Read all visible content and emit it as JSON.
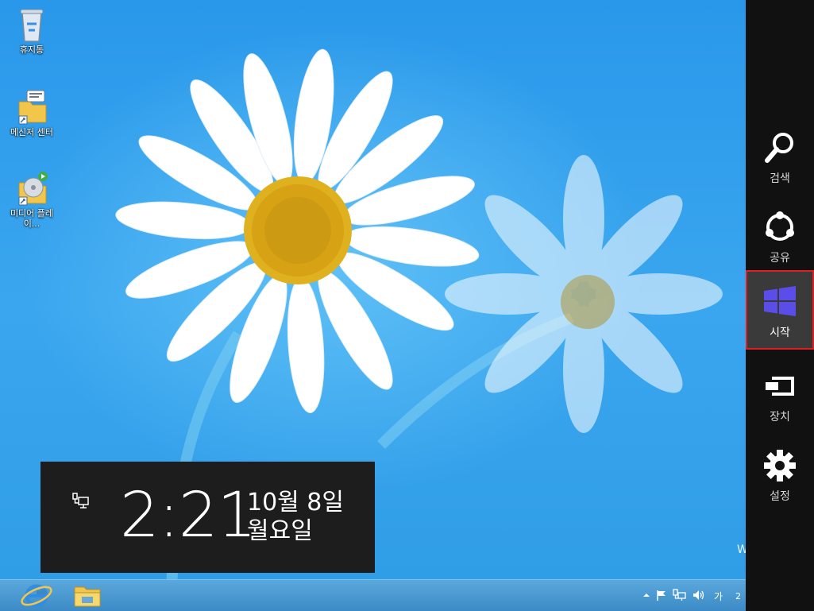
{
  "desktop": {
    "icons": [
      {
        "label": "휴지통",
        "icon": "recycle-bin-icon"
      },
      {
        "label": "메신저 센터",
        "icon": "messenger-center-icon"
      },
      {
        "label": "미디어 플레이...",
        "icon": "media-player-icon"
      }
    ]
  },
  "clock": {
    "time": "2:21",
    "date": "10월 8일",
    "weekday": "월요일",
    "network_icon": "network-icon"
  },
  "charms": {
    "items": [
      {
        "label": "검색",
        "icon": "search-icon"
      },
      {
        "label": "공유",
        "icon": "share-icon"
      },
      {
        "label": "시작",
        "icon": "windows-start-icon"
      },
      {
        "label": "장치",
        "icon": "devices-icon"
      },
      {
        "label": "설정",
        "icon": "settings-gear-icon"
      }
    ],
    "highlighted": "시작"
  },
  "taskbar": {
    "pinned": [
      {
        "icon": "internet-explorer-icon"
      },
      {
        "icon": "file-explorer-icon"
      }
    ],
    "tray": {
      "show_hidden_icon": "chevron-up-icon",
      "flag_icon": "action-center-flag-icon",
      "network_icon": "network-icon",
      "volume_icon": "volume-icon",
      "language": "가",
      "clock_peek": "2"
    }
  },
  "watermark_peek": "W",
  "colors": {
    "charms_background": "#111111",
    "charm_highlight": "#3a3a3a",
    "highlight_border": "#e02020",
    "windows_logo": "#5b4de8",
    "clock_panel": "#1d1d1d"
  }
}
